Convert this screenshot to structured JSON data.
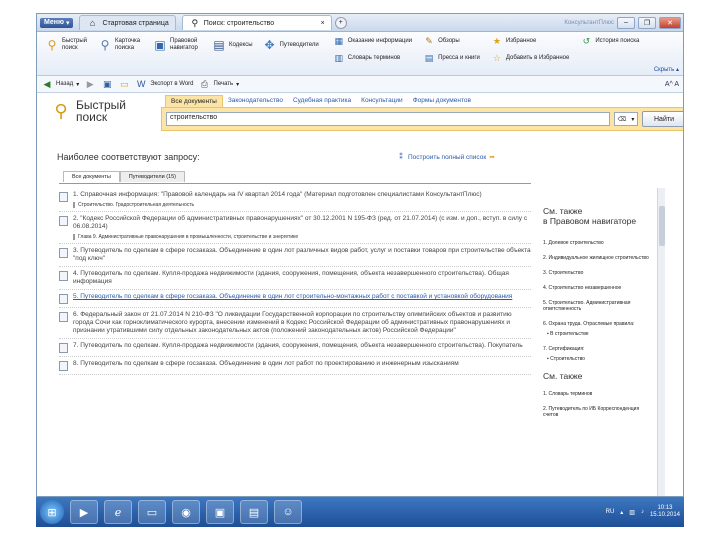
{
  "window": {
    "menu_label": "Меню",
    "tab_start": "Стартовая страница",
    "tab_active": "Поиск: строительство",
    "tab_close": "×",
    "tab_add": "+",
    "title_right": "КонсультантПлюс"
  },
  "toolbar": {
    "quick_search": "Быстрый поиск",
    "card_search": "Карточка поиска",
    "legal_nav": "Правовой навигатор",
    "codes": "Кодексы",
    "reviews": "Путеводители",
    "news": "Оказание информации",
    "forms": "Обзоры",
    "dictionary": "Словарь терминов",
    "press": "Пресса и книги",
    "favorites": "Избранное",
    "history": "История поиска",
    "add_favorites": "Добавить в Избранное",
    "hide": "Скрыть"
  },
  "nav": {
    "back": "Назад",
    "export_word": "Экспорт в Word",
    "print": "Печать",
    "font": "A^ A"
  },
  "search": {
    "logo_line1": "Быстрый",
    "logo_line2": "поиск",
    "tabs": [
      "Все документы",
      "Законодательство",
      "Судебная практика",
      "Консультации",
      "Формы документов"
    ],
    "query": "строительство",
    "button": "Найти"
  },
  "results": {
    "heading": "Наиболее соответствуют запросу:",
    "build_full": "Построить полный список",
    "tab_all": "Все документы",
    "tab_reviews": "Путеводители (15)",
    "items": [
      {
        "text": "1. Справочная информация: \"Правовой календарь на IV квартал 2014 года\" (Материал подготовлен специалистами КонсультантПлюс)",
        "sub": "Строительство. Градостроительная деятельность"
      },
      {
        "text": "2. \"Кодекс Российской Федерации об административных правонарушениях\" от 30.12.2001 N 195-ФЗ (ред. от 21.07.2014) (с изм. и доп., вступ. в силу с 06.08.2014)",
        "sub": "Глава 9. Административные правонарушения в промышленности, строительстве и энергетике"
      },
      {
        "text": "3. Путеводитель по сделкам в сфере госзаказа. Объединение в один лот различных видов работ, услуг и поставки товаров при строительстве объекта \"под ключ\"",
        "sub": ""
      },
      {
        "text": "4. Путеводитель по сделкам. Купля-продажа недвижимости (здания, сооружения, помещения, объекта незавершенного строительства). Общая информация",
        "sub": ""
      },
      {
        "text": "5. Путеводитель по сделкам в сфере госзаказа. Объединение в один лот строительно-монтажных работ с поставкой и установкой оборудования",
        "sub": "",
        "link": true
      },
      {
        "text": "6. Федеральный закон от 21.07.2014 N 210-ФЗ \"О ликвидации Государственной корпорации по строительству олимпийских объектов и развитию города Сочи как горноклиматического курорта, внесении изменений в Кодекс Российской Федерации об административных правонарушениях и признании утратившими силу отдельных законодательных актов (положений законодательных актов) Российской Федерации\"",
        "sub": ""
      },
      {
        "text": "7. Путеводитель по сделкам. Купля-продажа недвижимости (здания, сооружения, помещения, объекта незавершенного строительства). Покупатель",
        "sub": ""
      },
      {
        "text": "8. Путеводитель по сделкам в сфере госзаказа. Объединение в один лот работ по проектированию и инженерным изысканиям",
        "sub": ""
      }
    ]
  },
  "right_panel": {
    "heading1_line1": "См. также",
    "heading1_line2": "в Правовом навигаторе",
    "items": [
      "1. Долевое строительство",
      "2. Индивидуальное жилищное строительство",
      "3. Строительство",
      "4. Строительство незавершенное",
      "5. Строительство. Административная ответственность",
      "6. Охрана труда. Отраслевые правила:"
    ],
    "sub6": "▪ В строительстве",
    "item7": "7. Сертификация:",
    "sub7": "▪ Строительство",
    "heading2": "См. также",
    "items2": [
      "1. Словарь терминов",
      "2. Путеводитель по ИБ Корреспонденция счетов"
    ]
  },
  "taskbar": {
    "lang": "RU",
    "time": "10:13",
    "date": "15.10.2014"
  }
}
